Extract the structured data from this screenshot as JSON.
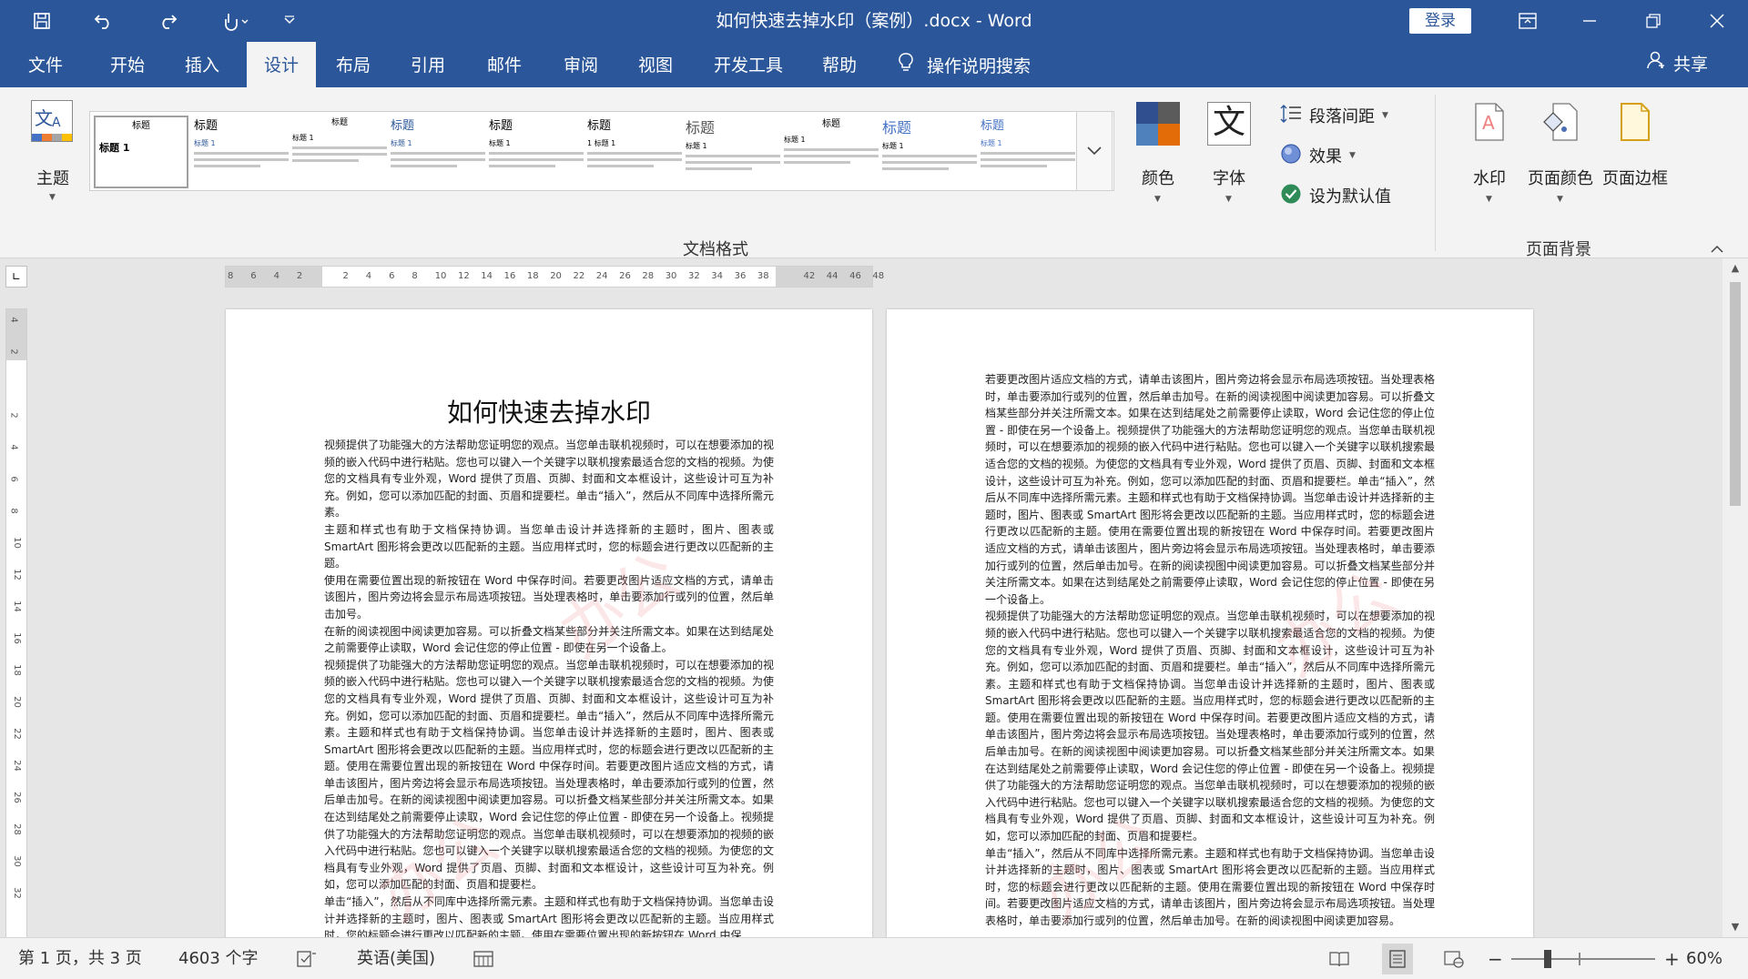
{
  "titlebar": {
    "title": "如何快速去掉水印（案例）.docx  -  Word",
    "login": "登录"
  },
  "tabs": [
    "文件",
    "开始",
    "插入",
    "设计",
    "布局",
    "引用",
    "邮件",
    "审阅",
    "视图",
    "开发工具",
    "帮助"
  ],
  "active_tab": "设计",
  "tellme": "操作说明搜索",
  "share": "共享",
  "ribbon": {
    "theme_label": "主题",
    "gallery_items": [
      {
        "heading": "标题",
        "sub": "标题 1"
      },
      {
        "heading": "标题",
        "sub": "标题 1"
      },
      {
        "heading": "标题",
        "sub": "标题 1"
      },
      {
        "heading": "标题",
        "sub": "标题 1"
      },
      {
        "heading": "标题",
        "sub": "标题 1"
      },
      {
        "heading": "标题",
        "sub": "1  标题 1"
      },
      {
        "heading": "标题",
        "sub": "标题 1"
      },
      {
        "heading": "标题",
        "sub": "标题 1"
      },
      {
        "heading": "标题",
        "sub": "标题 1"
      },
      {
        "heading": "标题",
        "sub": "标题 1"
      }
    ],
    "colors_label": "颜色",
    "fonts_label": "字体",
    "paragraph_spacing": "段落间距",
    "effects": "效果",
    "set_default": "设为默认值",
    "group_doc_format": "文档格式",
    "watermark_label": "水印",
    "page_color_label": "页面颜色",
    "page_borders_label": "页面边框",
    "group_page_bg": "页面背景"
  },
  "ruler": {
    "h_ticks": [
      "8",
      "6",
      "4",
      "2",
      "",
      "2",
      "4",
      "6",
      "8",
      "10",
      "12",
      "14",
      "16",
      "18",
      "20",
      "22",
      "24",
      "26",
      "28",
      "30",
      "32",
      "34",
      "36",
      "38",
      "",
      "42",
      "44",
      "46",
      "48"
    ],
    "v_ticks": [
      "4",
      "2",
      "",
      "2",
      "4",
      "6",
      "8",
      "10",
      "12",
      "14",
      "16",
      "18",
      "20",
      "22",
      "24",
      "26",
      "28",
      "30",
      "32"
    ]
  },
  "page1": {
    "title": "如何快速去掉水印",
    "body": "视频提供了功能强大的方法帮助您证明您的观点。当您单击联机视频时，可以在想要添加的视频的嵌入代码中进行粘贴。您也可以键入一个关键字以联机搜索最适合您的文档的视频。为使您的文档具有专业外观，Word 提供了页眉、页脚、封面和文本框设计，这些设计可互为补充。例如，您可以添加匹配的封面、页眉和提要栏。单击“插入”，然后从不同库中选择所需元素。\n主题和样式也有助于文档保持协调。当您单击设计并选择新的主题时，图片、图表或 SmartArt 图形将会更改以匹配新的主题。当应用样式时，您的标题会进行更改以匹配新的主题。\n使用在需要位置出现的新按钮在 Word 中保存时间。若要更改图片适应文档的方式，请单击该图片，图片旁边将会显示布局选项按钮。当处理表格时，单击要添加行或列的位置，然后单击加号。\n在新的阅读视图中阅读更加容易。可以折叠文档某些部分并关注所需文本。如果在达到结尾处之前需要停止读取，Word 会记住您的停止位置 - 即使在另一个设备上。\n视频提供了功能强大的方法帮助您证明您的观点。当您单击联机视频时，可以在想要添加的视频的嵌入代码中进行粘贴。您也可以键入一个关键字以联机搜索最适合您的文档的视频。为使您的文档具有专业外观，Word 提供了页眉、页脚、封面和文本框设计，这些设计可互为补充。例如，您可以添加匹配的封面、页眉和提要栏。单击“插入”，然后从不同库中选择所需元素。主题和样式也有助于文档保持协调。当您单击设计并选择新的主题时，图片、图表或 SmartArt 图形将会更改以匹配新的主题。当应用样式时，您的标题会进行更改以匹配新的主题。使用在需要位置出现的新按钮在 Word 中保存时间。若要更改图片适应文档的方式，请单击该图片，图片旁边将会显示布局选项按钮。当处理表格时，单击要添加行或列的位置，然后单击加号。在新的阅读视图中阅读更加容易。可以折叠文档某些部分并关注所需文本。如果在达到结尾处之前需要停止读取，Word 会记住您的停止位置 - 即使在另一个设备上。视频提供了功能强大的方法帮助您证明您的观点。当您单击联机视频时，可以在想要添加的视频的嵌入代码中进行粘贴。您也可以键入一个关键字以联机搜索最适合您的文档的视频。为使您的文档具有专业外观，Word 提供了页眉、页脚、封面和文本框设计，这些设计可互为补充。例如，您可以添加匹配的封面、页眉和提要栏。\n单击“插入”，然后从不同库中选择所需元素。主题和样式也有助于文档保持协调。当您单击设计并选择新的主题时，图片、图表或 SmartArt 图形将会更改以匹配新的主题。当应用样式时，您的标题会进行更改以匹配新的主题。使用在需要位置出现的新按钮在 Word 中保"
  },
  "page2": {
    "body": "若要更改图片适应文档的方式，请单击该图片，图片旁边将会显示布局选项按钮。当处理表格时，单击要添加行或列的位置，然后单击加号。在新的阅读视图中阅读更加容易。可以折叠文档某些部分并关注所需文本。如果在达到结尾处之前需要停止读取，Word 会记住您的停止位置 - 即使在另一个设备上。视频提供了功能强大的方法帮助您证明您的观点。当您单击联机视频时，可以在想要添加的视频的嵌入代码中进行粘贴。您也可以键入一个关键字以联机搜索最适合您的文档的视频。为使您的文档具有专业外观，Word 提供了页眉、页脚、封面和文本框设计，这些设计可互为补充。例如，您可以添加匹配的封面、页眉和提要栏。单击“插入”，然后从不同库中选择所需元素。主题和样式也有助于文档保持协调。当您单击设计并选择新的主题时，图片、图表或 SmartArt 图形将会更改以匹配新的主题。当应用样式时，您的标题会进行更改以匹配新的主题。使用在需要位置出现的新按钮在 Word 中保存时间。若要更改图片适应文档的方式，请单击该图片，图片旁边将会显示布局选项按钮。当处理表格时，单击要添加行或列的位置，然后单击加号。在新的阅读视图中阅读更加容易。可以折叠文档某些部分并关注所需文本。如果在达到结尾处之前需要停止读取，Word 会记住您的停止位置 - 即使在另一个设备上。\n视频提供了功能强大的方法帮助您证明您的观点。当您单击联机视频时，可以在想要添加的视频的嵌入代码中进行粘贴。您也可以键入一个关键字以联机搜索最适合您的文档的视频。为使您的文档具有专业外观，Word 提供了页眉、页脚、封面和文本框设计，这些设计可互为补充。例如，您可以添加匹配的封面、页眉和提要栏。单击“插入”，然后从不同库中选择所需元素。主题和样式也有助于文档保持协调。当您单击设计并选择新的主题时，图片、图表或 SmartArt 图形将会更改以匹配新的主题。当应用样式时，您的标题会进行更改以匹配新的主题。使用在需要位置出现的新按钮在 Word 中保存时间。若要更改图片适应文档的方式，请单击该图片，图片旁边将会显示布局选项按钮。当处理表格时，单击要添加行或列的位置，然后单击加号。在新的阅读视图中阅读更加容易。可以折叠文档某些部分并关注所需文本。如果在达到结尾处之前需要停止读取，Word 会记住您的停止位置 - 即使在另一个设备上。视频提供了功能强大的方法帮助您证明您的观点。当您单击联机视频时，可以在想要添加的视频的嵌入代码中进行粘贴。您也可以键入一个关键字以联机搜索最适合您的文档的视频。为使您的文档具有专业外观，Word 提供了页眉、页脚、封面和文本框设计，这些设计可互为补充。例如，您可以添加匹配的封面、页眉和提要栏。\n单击“插入”，然后从不同库中选择所需元素。主题和样式也有助于文档保持协调。当您单击设计并选择新的主题时，图片、图表或 SmartArt 图形将会更改以匹配新的主题。当应用样式时，您的标题会进行更改以匹配新的主题。使用在需要位置出现的新按钮在 Word 中保存时间。若要更改图片适应文档的方式，请单击该图片，图片旁边将会显示布局选项按钮。当处理表格时，单击要添加行或列的位置，然后单击加号。在新的阅读视图中阅读更加容易。"
  },
  "statusbar": {
    "page": "第 1 页，共 3 页",
    "words": "4603 个字",
    "language": "英语(美国)",
    "zoom": "60%"
  },
  "colors": {
    "brand": "#2b579a",
    "ribbon_bg": "#f3f3f3",
    "workspace": "#e6e6e6"
  }
}
